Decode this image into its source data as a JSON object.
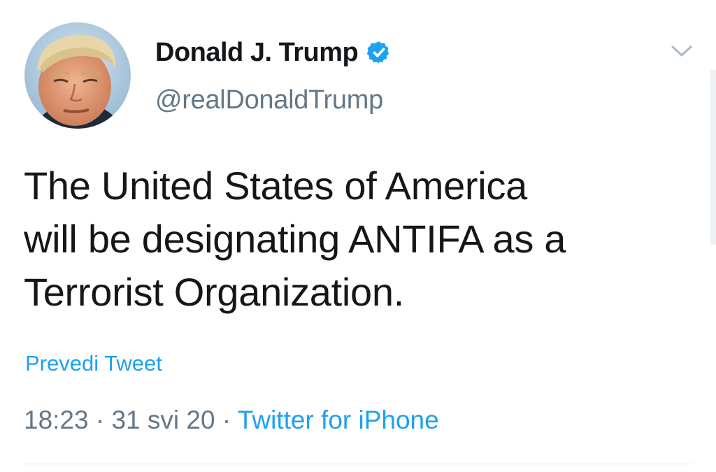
{
  "author": {
    "display_name": "Donald J. Trump",
    "handle": "@realDonaldTrump",
    "verified_icon": "verified-badge-icon",
    "verified_color": "#1da1f2"
  },
  "tweet": {
    "lines": [
      "The United States of America",
      "will be designating ANTIFA as a",
      "Terrorist Organization."
    ]
  },
  "translate_label": "Prevedi Tweet",
  "meta": {
    "time": "18:23",
    "separator": "·",
    "date": "31 svi 20",
    "source": "Twitter for iPhone"
  },
  "icons": {
    "menu": "chevron-down-icon",
    "avatar": "avatar"
  },
  "colors": {
    "text": "#14171a",
    "secondary": "#657786",
    "link": "#1da1f2",
    "divider": "#e1e8ed"
  }
}
